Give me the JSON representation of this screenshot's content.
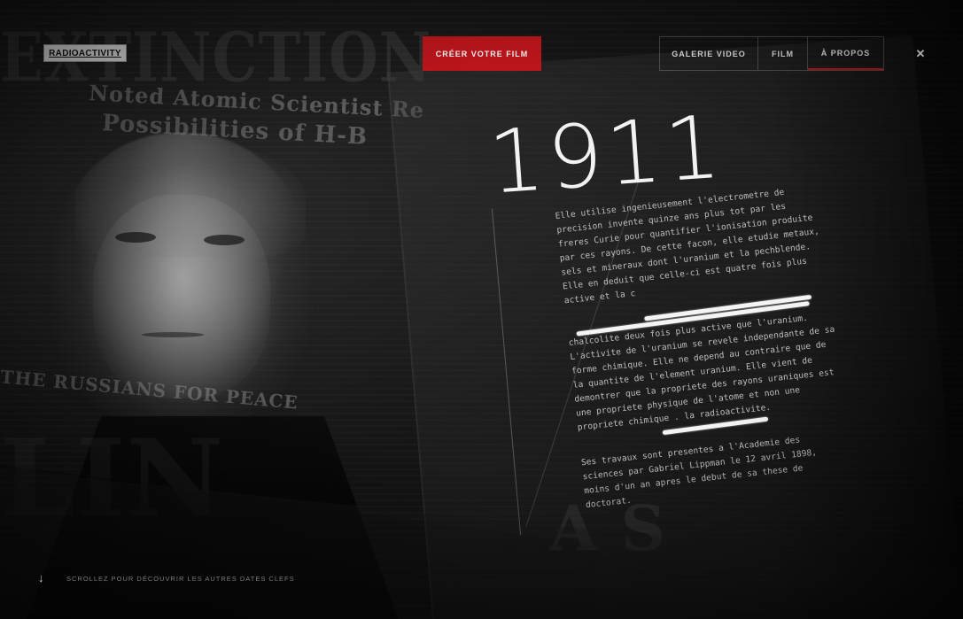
{
  "header": {
    "logo_text": "RADIOACTIVITY",
    "cta_label": "CRÉER VOTRE FILM",
    "nav": [
      {
        "label": "GALERIE VIDEO"
      },
      {
        "label": "FILM"
      },
      {
        "label": "À PROPOS",
        "active": true
      }
    ],
    "close_icon": "close-icon"
  },
  "background": {
    "headlines": [
      "EXTINCTION",
      "Noted Atomic Scientist Re",
      "Possibilities of H-B",
      "THE RUSSIANS FOR PEACE",
      "LIN",
      "A S"
    ]
  },
  "main": {
    "year": "1911",
    "paragraphs": [
      {
        "lines": [
          "Elle utilise ingenieusement l'electrometre de",
          "precision invente quinze ans plus tot par les",
          "freres Curie pour quantifier l'ionisation produite",
          "par ces rayons. De cette facon, elle etudie metaux,",
          "sels et mineraux dont l'uranium et la pechblende.",
          "Elle en deduit que celle-ci est quatre fois plus",
          "active et la c"
        ]
      },
      {
        "lines": [
          "chalcolite deux fois plus active que l'uranium.",
          "L'activite de l'uranium se revele independante de sa",
          "forme chimique. Elle ne depend au contraire que de",
          "la quantite de l'element uranium. Elle vient de",
          "demontrer que la propriete des rayons uraniques est",
          "une propriete physique de l'atome et non une",
          "propriete chimique . la radioactivite."
        ]
      },
      {
        "lines": [
          "Ses travaux sont presentes a l'Academie des",
          "sciences par Gabriel Lippman le 12 avril 1898,",
          "moins d'un an apres le debut de sa these de",
          "doctorat."
        ]
      }
    ]
  },
  "footer": {
    "arrow_icon": "arrow-down-icon",
    "scroll_hint": "SCROLLEZ POUR DÉCOUVRIR LES AUTRES DATES CLEFS"
  },
  "colors": {
    "accent": "#c4161c",
    "background": "#0b0b0b",
    "text": "#bdbdbd"
  }
}
